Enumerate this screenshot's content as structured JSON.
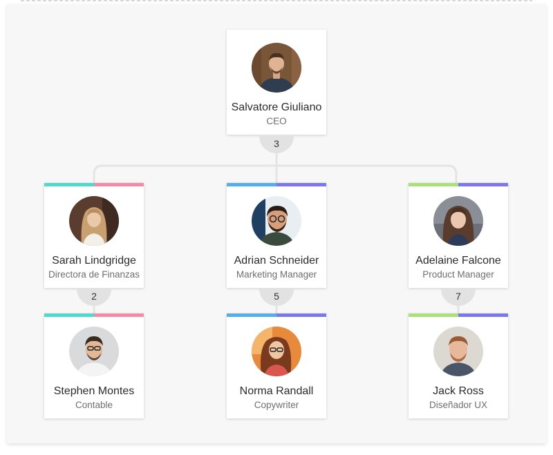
{
  "colors": {
    "teal": "#4ed9cf",
    "pink": "#f48aa5",
    "blue": "#54aee8",
    "purple": "#7b78ef",
    "green": "#a8e07a",
    "connector": "#e4e4e4",
    "badge": "#e2e2e2"
  },
  "ceo": {
    "name": "Salvatore Giuliano",
    "role": "CEO",
    "reports": "3"
  },
  "managers": [
    {
      "name": "Sarah Lindgridge",
      "role": "Directora de Finanzas",
      "reports": "2",
      "accent": [
        "teal",
        "pink"
      ]
    },
    {
      "name": "Adrian Schneider",
      "role": "Marketing Manager",
      "reports": "5",
      "accent": [
        "blue",
        "purple"
      ]
    },
    {
      "name": "Adelaine Falcone",
      "role": "Product Manager",
      "reports": "7",
      "accent": [
        "green",
        "purple"
      ]
    }
  ],
  "staff": [
    {
      "name": "Stephen Montes",
      "role": "Contable",
      "accent": [
        "teal",
        "pink"
      ]
    },
    {
      "name": "Norma Randall",
      "role": "Copywriter",
      "accent": [
        "blue",
        "purple"
      ]
    },
    {
      "name": "Jack Ross",
      "role": "Diseñador UX",
      "accent": [
        "green",
        "purple"
      ]
    }
  ]
}
